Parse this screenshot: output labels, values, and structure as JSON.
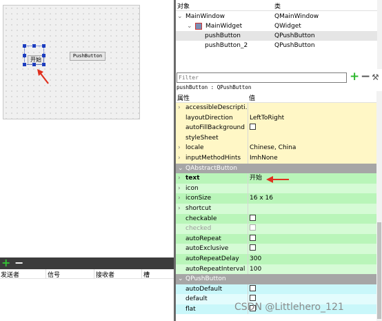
{
  "designer": {
    "buttons": {
      "start": "开始",
      "push": "PushButton"
    }
  },
  "signals": {
    "headers": [
      "发送者",
      "信号",
      "接收者",
      "槽"
    ]
  },
  "object_inspector": {
    "headers": [
      "对象",
      "类"
    ],
    "rows": [
      {
        "name": "MainWindow",
        "class": "QMainWindow"
      },
      {
        "name": "MainWidget",
        "class": "QWidget"
      },
      {
        "name": "pushButton",
        "class": "QPushButton"
      },
      {
        "name": "pushButton_2",
        "class": "QPushButton"
      }
    ]
  },
  "property_editor": {
    "filter_placeholder": "Filter",
    "object_label": "pushButton : QPushButton",
    "headers": [
      "属性",
      "值"
    ],
    "rows": [
      {
        "name": "accessibleDescripti...",
        "value": "",
        "expand": true,
        "color": "#fff7c6"
      },
      {
        "name": "layoutDirection",
        "value": "LeftToRight",
        "color": "#fff7c6"
      },
      {
        "name": "autoFillBackground",
        "check": true,
        "color": "#fff7c6"
      },
      {
        "name": "styleSheet",
        "value": "",
        "color": "#fff7c6"
      },
      {
        "name": "locale",
        "value": "Chinese, China",
        "expand": true,
        "color": "#fff7c6"
      },
      {
        "name": "inputMethodHints",
        "value": "ImhNone",
        "expand": true,
        "color": "#fff7c6"
      },
      {
        "name": "QAbstractButton",
        "group": true
      },
      {
        "name": "text",
        "value": "开始",
        "expand": true,
        "bold": true,
        "color": "#b9f5b9"
      },
      {
        "name": "icon",
        "value": "",
        "expand": true,
        "color": "#d5fbd5"
      },
      {
        "name": "iconSize",
        "value": "16 x 16",
        "expand": true,
        "color": "#b9f5b9"
      },
      {
        "name": "shortcut",
        "value": "",
        "expand": true,
        "color": "#d5fbd5"
      },
      {
        "name": "checkable",
        "check": true,
        "color": "#b9f5b9"
      },
      {
        "name": "checked",
        "check": true,
        "disabled": true,
        "color": "#d5fbd5"
      },
      {
        "name": "autoRepeat",
        "check": true,
        "color": "#b9f5b9"
      },
      {
        "name": "autoExclusive",
        "check": true,
        "color": "#d5fbd5"
      },
      {
        "name": "autoRepeatDelay",
        "value": "300",
        "color": "#b9f5b9"
      },
      {
        "name": "autoRepeatInterval",
        "value": "100",
        "color": "#d5fbd5"
      },
      {
        "name": "QPushButton",
        "group": true
      },
      {
        "name": "autoDefault",
        "check": true,
        "color": "#c9f7fa"
      },
      {
        "name": "default",
        "check": true,
        "color": "#e3fcfd"
      },
      {
        "name": "flat",
        "check": true,
        "color": "#c9f7fa"
      }
    ]
  },
  "watermark": "CSDN @Littlehero_121",
  "colors": {
    "selection": "#1c3dbf",
    "annotation": "#e0301e"
  }
}
